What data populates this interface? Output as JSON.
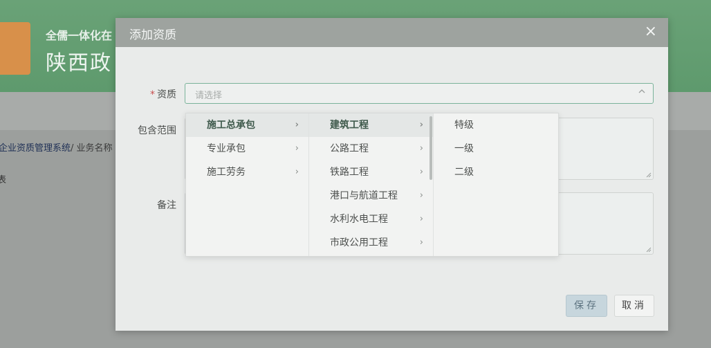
{
  "background": {
    "sub_title": "全儒一体化在",
    "main_title": "陕西政",
    "breadcrumb_link": "企业资质管理系统",
    "breadcrumb_sep": "/",
    "breadcrumb_current": "业务名称",
    "side_char": "表"
  },
  "dialog": {
    "title": "添加资质",
    "close_symbol": "×",
    "fields": {
      "qualification_label": "资质",
      "required_mark": "*",
      "qualification_placeholder": "请选择",
      "scope_label": "包含范围",
      "remarks_label": "备注"
    },
    "buttons": {
      "save": "保存",
      "cancel": "取消"
    }
  },
  "cascader": {
    "level1": [
      {
        "label": "施工总承包",
        "active": true
      },
      {
        "label": "专业承包",
        "active": false
      },
      {
        "label": "施工劳务",
        "active": false
      }
    ],
    "level2": [
      {
        "label": "建筑工程",
        "active": true
      },
      {
        "label": "公路工程",
        "active": false
      },
      {
        "label": "铁路工程",
        "active": false
      },
      {
        "label": "港口与航道工程",
        "active": false
      },
      {
        "label": "水利水电工程",
        "active": false
      },
      {
        "label": "市政公用工程",
        "active": false
      }
    ],
    "level3": [
      {
        "label": "特级"
      },
      {
        "label": "一级"
      },
      {
        "label": "二级"
      }
    ],
    "chevron": "›"
  },
  "colors": {
    "header_green": "#5e9a6d",
    "focus_border": "#7ab39a",
    "required_star": "#c84f4f",
    "save_button": "#c7d6dd"
  }
}
